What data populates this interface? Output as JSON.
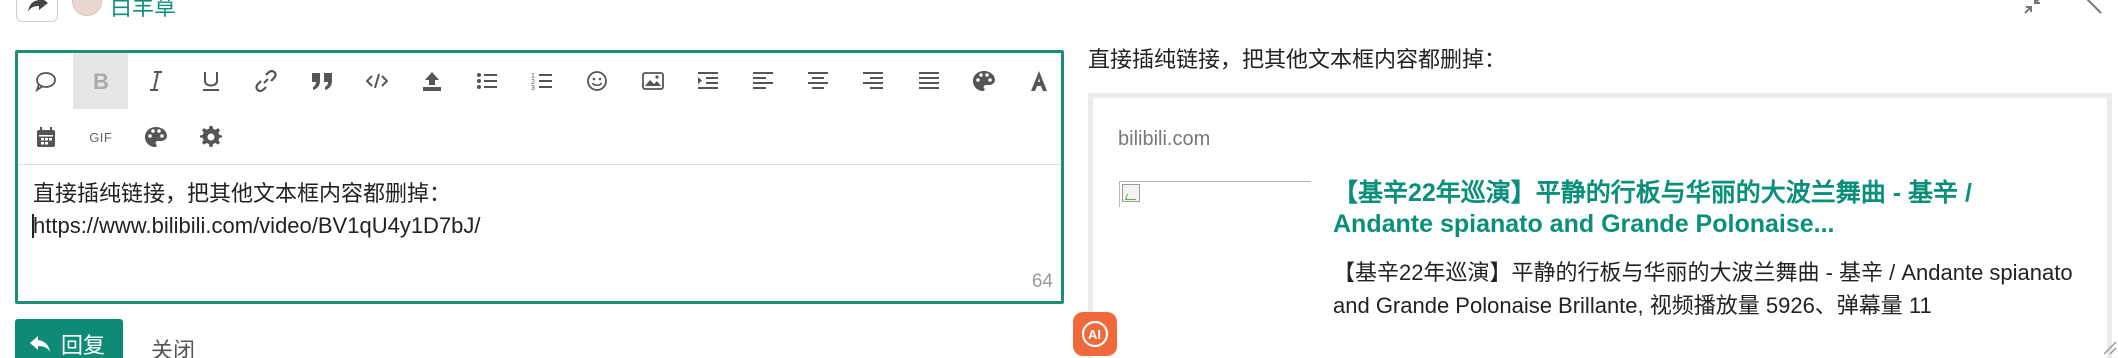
{
  "header": {
    "username": "白羊草",
    "reply_icon": "share-reply-icon",
    "avatar_icon": "user-avatar",
    "right_icons": [
      "collapse-icon",
      "expand-icon"
    ]
  },
  "toolbar": {
    "row1": [
      {
        "name": "chat-bubble-icon",
        "title": "quote-whole-post"
      },
      {
        "name": "bold-icon",
        "active": true
      },
      {
        "name": "italic-icon"
      },
      {
        "name": "underline-icon"
      },
      {
        "name": "link-icon"
      },
      {
        "name": "blockquote-icon"
      },
      {
        "name": "code-icon"
      },
      {
        "name": "upload-icon"
      },
      {
        "name": "bullet-list-icon"
      },
      {
        "name": "numbered-list-icon"
      },
      {
        "name": "emoji-icon"
      },
      {
        "name": "image-icon"
      },
      {
        "name": "indent-icon"
      },
      {
        "name": "align-left-icon"
      },
      {
        "name": "align-center-icon"
      },
      {
        "name": "align-right-icon"
      },
      {
        "name": "align-justify-icon"
      },
      {
        "name": "palette-icon"
      },
      {
        "name": "font-icon"
      }
    ],
    "row2": [
      {
        "name": "calendar-icon"
      },
      {
        "name": "gif-icon",
        "label": "GIF"
      },
      {
        "name": "palette-icon"
      },
      {
        "name": "gear-icon"
      }
    ]
  },
  "editor": {
    "line1": "直接插纯链接，把其他文本框内容都删掉：",
    "line2": "https://www.bilibili.com/video/BV1qU4y1D7bJ/",
    "char_count": "64"
  },
  "preview": {
    "text": "直接插纯链接，把其他文本框内容都删掉：",
    "onebox": {
      "source": "bilibili.com",
      "title": "【基辛22年巡演】平静的行板与华丽的大波兰舞曲 - 基辛 / Andante spianato and Grande Polonaise...",
      "description": "【基辛22年巡演】平静的行板与华丽的大波兰舞曲 - 基辛 / Andante spianato and Grande Polonaise Brillante, 视频播放量 5926、弹幕量 11"
    }
  },
  "footer": {
    "reply_label": "回复",
    "close_label": "关闭",
    "ai_badge": "AI"
  },
  "colors": {
    "accent": "#0f8a77",
    "editor_border": "#1d8f79",
    "ai_badge": "#f0693a"
  }
}
